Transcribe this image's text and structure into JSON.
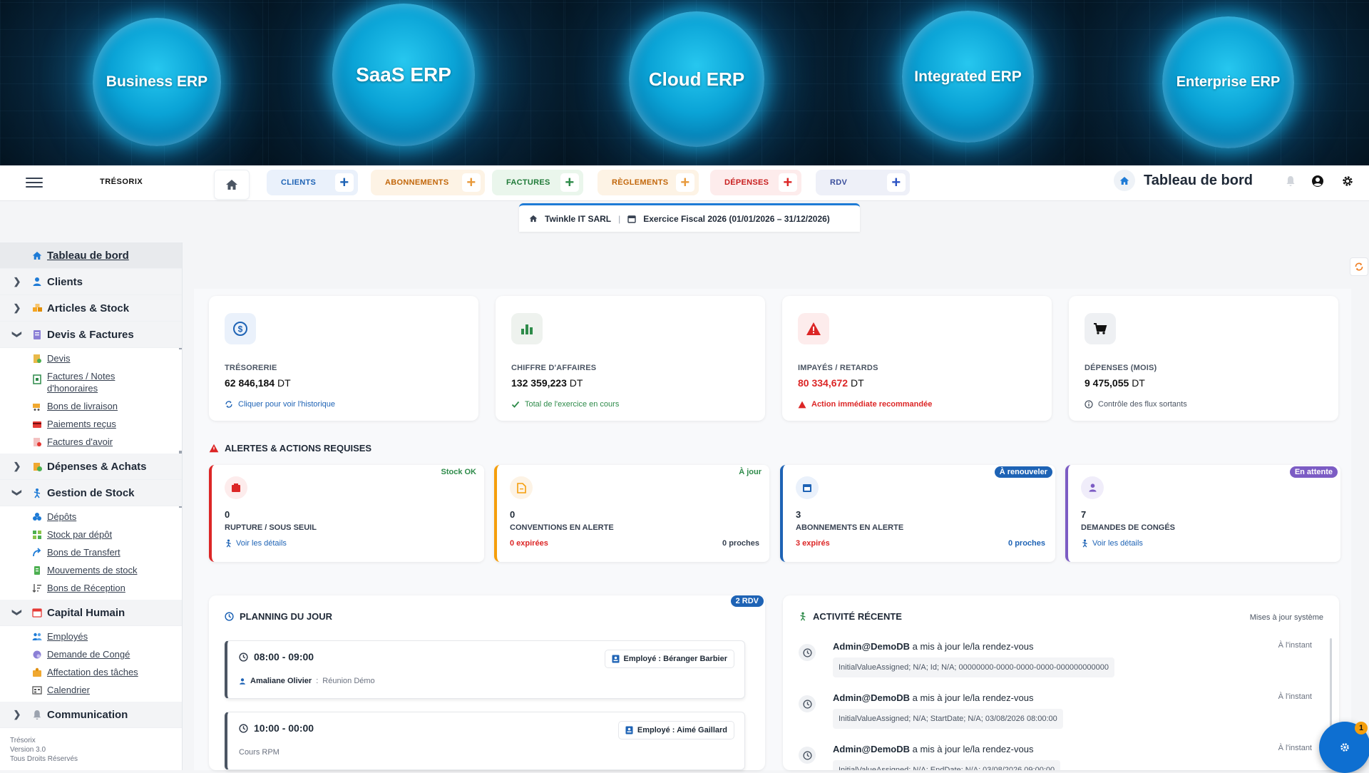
{
  "banner": {
    "items": [
      "Business ERP",
      "SaaS ERP",
      "Cloud ERP",
      "Integrated ERP",
      "Enterprise ERP"
    ]
  },
  "topbar": {
    "logo": "TRÉSORIX",
    "tabs": [
      {
        "label": "CLIENTS"
      },
      {
        "label": "ABONNEMENTS"
      },
      {
        "label": "FACTURES"
      },
      {
        "label": "RÈGLEMENTS"
      },
      {
        "label": "DÉPENSES"
      },
      {
        "label": "RDV"
      }
    ],
    "plus": "+",
    "page_title": "Tableau de bord"
  },
  "context": {
    "company": "Twinkle IT SARL",
    "separator": "|",
    "fiscal": "Exercice Fiscal 2026 (01/01/2026 – 31/12/2026)"
  },
  "sidebar": {
    "items": [
      {
        "label": "Tableau de bord"
      },
      {
        "label": "Clients"
      },
      {
        "label": "Articles & Stock"
      },
      {
        "label": "Devis & Factures"
      },
      {
        "label": "Dépenses & Achats"
      },
      {
        "label": "Gestion de Stock"
      },
      {
        "label": "Capital Humain"
      },
      {
        "label": "Communication"
      }
    ],
    "devis_sub": [
      "Devis",
      "Factures / Notes d'honoraires",
      "Bons de livraison",
      "Paiements reçus",
      "Factures d'avoir"
    ],
    "stock_sub": [
      "Dépôts",
      "Stock par dépôt",
      "Bons de Transfert",
      "Mouvements de stock",
      "Bons de Réception"
    ],
    "rh_sub": [
      "Employés",
      "Demande de Congé",
      "Affectation des tâches",
      "Calendrier"
    ],
    "footer": {
      "app": "Trésorix",
      "version": "Version 3.0",
      "rights": "Tous Droits Réservés"
    }
  },
  "kpis": [
    {
      "label": "TRÉSORERIE",
      "value": "62 846,184",
      "unit": "DT",
      "foot": "Cliquer pour voir l'historique"
    },
    {
      "label": "CHIFFRE D'AFFAIRES",
      "value": "132 359,223",
      "unit": "DT",
      "foot": "Total de l'exercice en cours"
    },
    {
      "label": "IMPAYÉS / RETARDS",
      "value": "80 334,672",
      "unit": "DT",
      "foot": "Action immédiate recommandée"
    },
    {
      "label": "DÉPENSES (MOIS)",
      "value": "9 475,055",
      "unit": "DT",
      "foot": "Contrôle des flux sortants"
    }
  ],
  "alerts": {
    "title": "ALERTES & ACTIONS REQUISES",
    "items": [
      {
        "badge": "Stock OK",
        "count": "0",
        "label": "RUPTURE / SOUS SEUIL",
        "link": "Voir les détails",
        "right": ""
      },
      {
        "badge": "À jour",
        "count": "0",
        "label": "CONVENTIONS EN ALERTE",
        "link": "0 expirées",
        "right": "0 proches"
      },
      {
        "badge": "À renouveler",
        "count": "3",
        "label": "ABONNEMENTS EN ALERTE",
        "link": "3 expirés",
        "right": "0 proches"
      },
      {
        "badge": "En attente",
        "count": "7",
        "label": "DEMANDES DE CONGÉS",
        "link": "Voir les détails",
        "right": ""
      }
    ]
  },
  "planning": {
    "title": "PLANNING DU JOUR",
    "badge": "2 RDV",
    "slots": [
      {
        "time": "08:00 - 09:00",
        "employee": "Employé : Béranger Barbier",
        "client": "Amaliane Olivier",
        "sep": ":",
        "note": "Réunion Démo"
      },
      {
        "time": "10:00 - 00:00",
        "employee": "Employé : Aimé Gaillard",
        "client": "",
        "sep": "",
        "note": "Cours RPM"
      }
    ]
  },
  "activity": {
    "title": "ACTIVITÉ RÉCENTE",
    "subtitle": "Mises à jour système",
    "items": [
      {
        "user": "Admin@DemoDB",
        "action": "a mis à jour le/la rendez-vous",
        "time": "À l'instant",
        "detail": "InitialValueAssigned; N/A; Id; N/A; 00000000-0000-0000-0000-000000000000"
      },
      {
        "user": "Admin@DemoDB",
        "action": "a mis à jour le/la rendez-vous",
        "time": "À l'instant",
        "detail": "InitialValueAssigned; N/A; StartDate; N/A; 03/08/2026 08:00:00"
      },
      {
        "user": "Admin@DemoDB",
        "action": "a mis à jour le/la rendez-vous",
        "time": "À l'instant",
        "detail": "InitialValueAssigned; N/A; EndDate; N/A; 03/08/2026 09:00:00"
      }
    ]
  },
  "fab": {
    "badge": "1"
  },
  "colors": {
    "primary": "#1e7bd6",
    "danger": "#dc2626",
    "success": "#16a34a",
    "warning": "#f59e0b",
    "purple": "#7c5cc4"
  }
}
